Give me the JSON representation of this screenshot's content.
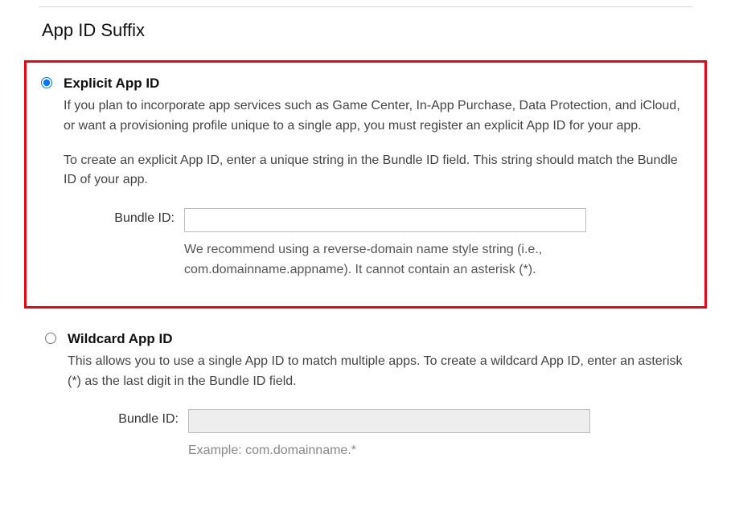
{
  "section": {
    "title": "App ID Suffix"
  },
  "explicit": {
    "title": "Explicit App ID",
    "desc1": "If you plan to incorporate app services such as Game Center, In-App Purchase, Data Protection, and iCloud, or want a provisioning profile unique to a single app, you must register an explicit App ID for your app.",
    "desc2": "To create an explicit App ID, enter a unique string in the Bundle ID field. This string should match the Bundle ID of your app.",
    "field_label": "Bundle ID:",
    "field_value": "",
    "hint": "We recommend using a reverse-domain name style string (i.e., com.domainname.appname). It cannot contain an asterisk (*)."
  },
  "wildcard": {
    "title": "Wildcard App ID",
    "desc": "This allows you to use a single App ID to match multiple apps. To create a wildcard App ID, enter an asterisk (*) as the last digit in the Bundle ID field.",
    "field_label": "Bundle ID:",
    "field_value": "",
    "hint": "Example: com.domainname.*"
  }
}
